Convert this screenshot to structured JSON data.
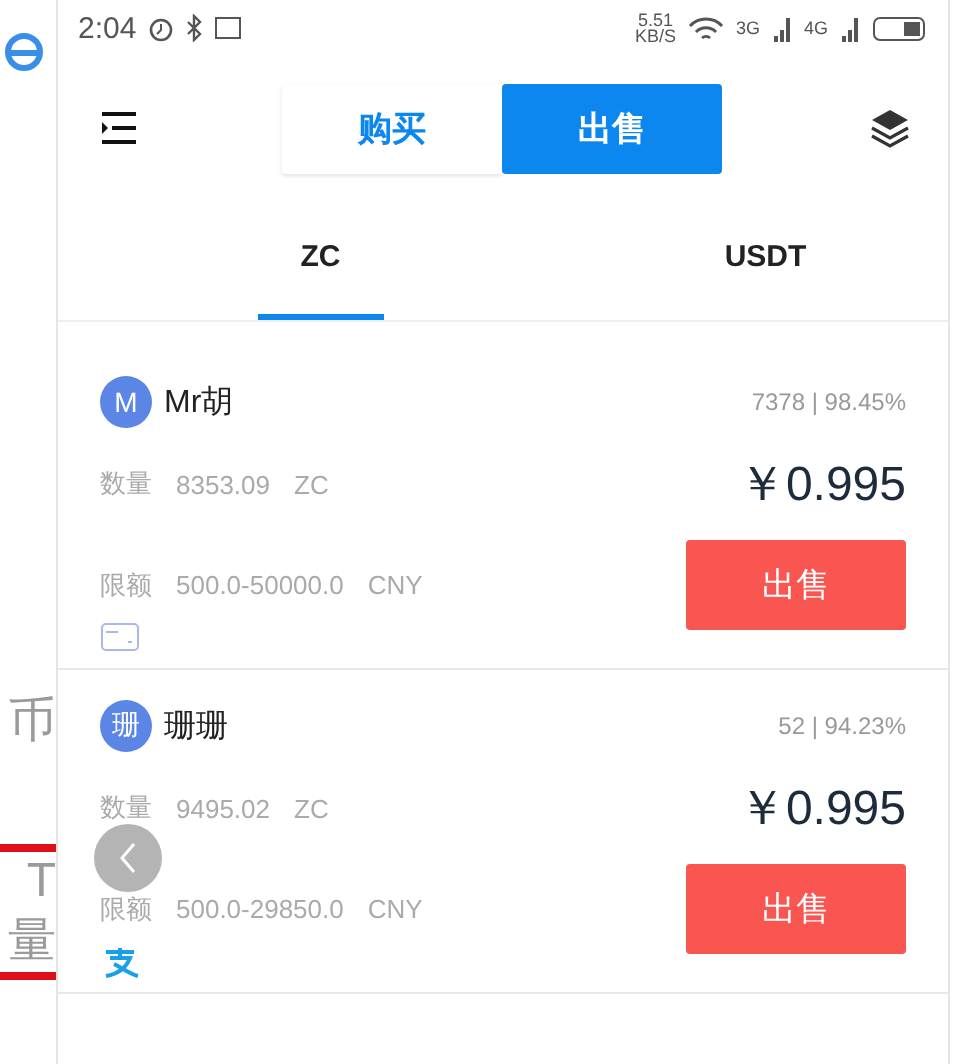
{
  "status_bar": {
    "time": "2:04",
    "net_speed": "5.51",
    "net_unit": "KB/S",
    "signal_1": "3G",
    "signal_2": "4G"
  },
  "header": {
    "segments": [
      {
        "label": "购买",
        "selected": false
      },
      {
        "label": "出售",
        "selected": true
      }
    ]
  },
  "coin_tabs": [
    {
      "label": "ZC",
      "selected": true
    },
    {
      "label": "USDT",
      "selected": false
    }
  ],
  "offers": [
    {
      "avatar": "M",
      "name": "Mr胡",
      "stats": "7378 | 98.45%",
      "qty_label": "数量",
      "qty": "8353.09",
      "qty_unit": "ZC",
      "price": "￥0.995",
      "limit_label": "限额",
      "limit": "500.0-50000.0",
      "limit_unit": "CNY",
      "payment": {
        "kind": "card"
      },
      "action": "出售"
    },
    {
      "avatar": "珊",
      "name": "珊珊",
      "stats": "52 | 94.23%",
      "qty_label": "数量",
      "qty": "9495.02",
      "qty_unit": "ZC",
      "price": "￥0.995",
      "limit_label": "限额",
      "limit": "500.0-29850.0",
      "limit_unit": "CNY",
      "payment": {
        "kind": "alipay"
      },
      "action": "出售"
    }
  ],
  "background_fragments": [
    "币",
    "T",
    "量"
  ]
}
